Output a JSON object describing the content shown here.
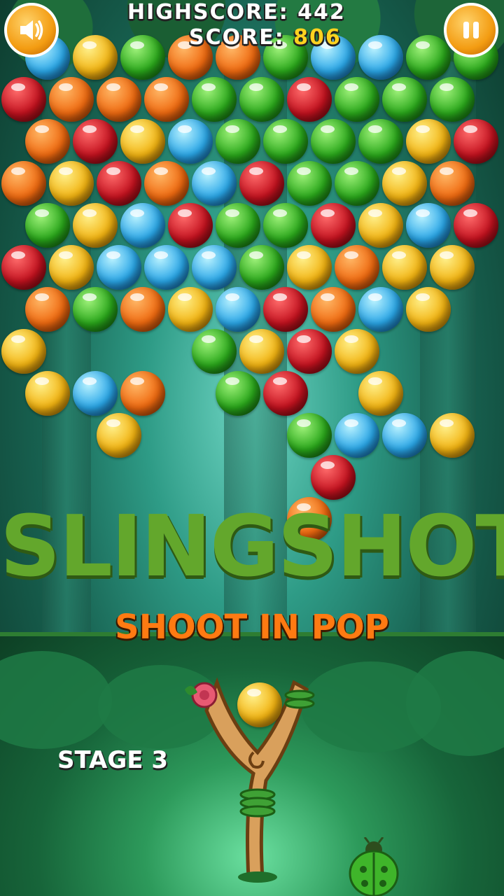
{
  "hud": {
    "highscore_label": "HIGHSCORE:",
    "highscore_value": "442",
    "score_label": "SCORE:",
    "score_value": "806",
    "sound_icon": "speaker-icon",
    "pause_icon": "pause-icon"
  },
  "title": {
    "main": "SLINGSHOT",
    "subtitle": "SHOOT IN POP"
  },
  "stage_label": "STAGE 3",
  "colors": {
    "red": "#c4121f",
    "orange": "#f06a10",
    "yellow": "#f2b311",
    "green": "#2aa81b",
    "blue": "#2aa7e8",
    "score_accent": "#ffd21f",
    "title_green": "#63a72c",
    "subtitle_orange": "#ff7a12"
  },
  "board": {
    "rows": [
      [
        "blue",
        "yellow",
        "green",
        "orange",
        "orange",
        "green",
        "blue",
        "blue",
        "green",
        "green"
      ],
      [
        "red",
        "orange",
        "orange",
        "orange",
        "green",
        "green",
        "red",
        "green",
        "green",
        "green"
      ],
      [
        "orange",
        "red",
        "yellow",
        "blue",
        "green",
        "green",
        "green",
        "green",
        "yellow",
        "red"
      ],
      [
        "orange",
        "yellow",
        "red",
        "orange",
        "blue",
        "red",
        "green",
        "green",
        "yellow",
        "orange"
      ],
      [
        "green",
        "yellow",
        "blue",
        "red",
        "green",
        "green",
        "red",
        "yellow",
        "blue",
        "red"
      ],
      [
        "red",
        "yellow",
        "blue",
        "blue",
        "blue",
        "green",
        "yellow",
        "orange",
        "yellow",
        "yellow"
      ],
      [
        "orange",
        "green",
        "orange",
        "yellow",
        "blue",
        "red",
        "orange",
        "blue",
        "yellow",
        ""
      ],
      [
        "yellow",
        "",
        "",
        "",
        "green",
        "yellow",
        "red",
        "yellow",
        "",
        ""
      ],
      [
        "yellow",
        "blue",
        "orange",
        "",
        "green",
        "red",
        "",
        "yellow",
        "",
        ""
      ],
      [
        "",
        "",
        "yellow",
        "",
        "",
        "",
        "green",
        "blue",
        "blue",
        "yellow"
      ],
      [
        "",
        "",
        "",
        "",
        "",
        "",
        "red",
        "",
        "",
        ""
      ],
      [
        "",
        "",
        "",
        "",
        "",
        "",
        "orange",
        "",
        "",
        ""
      ]
    ],
    "loaded_ball": "yellow"
  },
  "ladybug_icon": "ladybug-icon"
}
